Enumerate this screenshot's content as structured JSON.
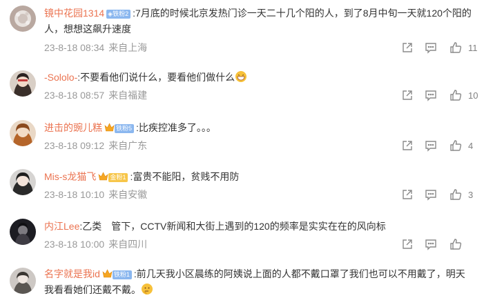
{
  "comments": [
    {
      "username": "镜中花园1314",
      "badge": "铁粉2",
      "badge_type": "fan",
      "text": ":7月底的时候北京发热门诊一天二十几个阳的人，到了8月中旬一天就120个阳的人，想想这飙升速度",
      "time": "23-8-18 08:34",
      "location": "来自上海",
      "likes": "11"
    },
    {
      "username": "-Sololo-",
      "badge": "",
      "badge_type": "",
      "text": ":不要看他们说什么，要看他们做什么",
      "time": "23-8-18 08:57",
      "location": "来自福建",
      "likes": "10"
    },
    {
      "username": "进击的豌儿糕",
      "badge": "铁粉5",
      "badge_type": "fan",
      "text": ":比疾控准多了。。。",
      "time": "23-8-18 09:12",
      "location": "来自广东",
      "likes": "4"
    },
    {
      "username": "Mis-s龙猫飞",
      "badge": "金粉1",
      "badge_type": "gold",
      "text": ":富贵不能阳，贫贱不用防",
      "time": "23-8-18 10:10",
      "location": "来自安徽",
      "likes": "3"
    },
    {
      "username": "内江Lee",
      "badge": "",
      "badge_type": "",
      "text": ":乙类　管下，CCTV新闻和大街上遇到的120的频率是实实在在的风向标",
      "time": "23-8-18 10:00",
      "location": "来自四川",
      "likes": ""
    },
    {
      "username": "名字就是我id",
      "badge": "铁粉1",
      "badge_type": "fan",
      "text": ":前几天我小区晨练的阿姨说上面的人都不戴口罩了我们也可以不用戴了，明天我看看她们还戴不戴。",
      "time": "",
      "location": "",
      "likes": ""
    }
  ],
  "icons": {
    "share": "share-icon",
    "reply": "comment-icon",
    "like": "thumbs-up-icon",
    "crown": "crown-icon",
    "emoji_grin": "grin-emoji-icon",
    "emoji_think": "thinking-emoji-icon"
  },
  "colors": {
    "username": "#eb7350",
    "meta": "#999999",
    "badge_fan": "#8bb7ef",
    "badge_gold": "#f7c64a"
  }
}
